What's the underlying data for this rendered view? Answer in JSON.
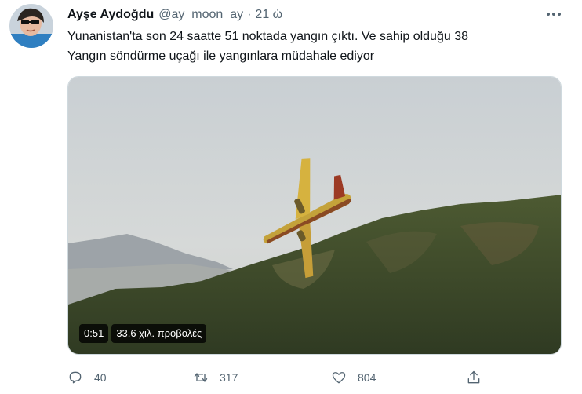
{
  "tweet": {
    "display_name": "Ayşe Aydoğdu",
    "handle": "@ay_moon_ay",
    "separator": "·",
    "time": "21 ώ",
    "text_line1": "Yunanistan'ta son 24 saatte 51 noktada yangın çıktı. Ve sahip olduğu 38",
    "text_line2": "Yangın söndürme uçağı ile yangınlara müdahale ediyor",
    "video": {
      "duration": "0:51",
      "views": "33,6 χιλ. προβολές"
    },
    "actions": {
      "reply_count": "40",
      "retweet_count": "317",
      "like_count": "804"
    }
  },
  "icons": {
    "reply": "reply-icon",
    "retweet": "retweet-icon",
    "like": "heart-icon",
    "share": "share-icon",
    "more": "more-icon"
  }
}
